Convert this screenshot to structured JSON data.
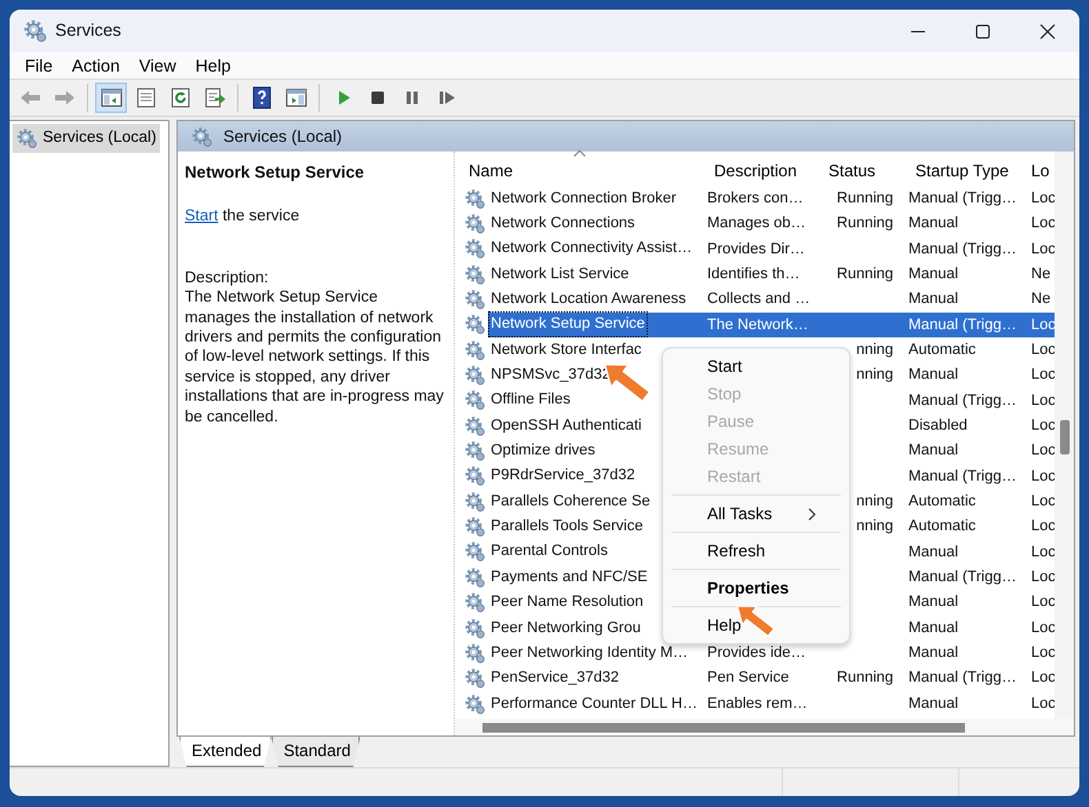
{
  "window": {
    "title": "Services"
  },
  "menu_bar": [
    "File",
    "Action",
    "View",
    "Help"
  ],
  "toolbar": [
    {
      "kind": "back",
      "disabled": true,
      "pressed": false
    },
    {
      "kind": "forward",
      "disabled": true,
      "pressed": false
    },
    {
      "kind": "separator"
    },
    {
      "kind": "console-tree",
      "disabled": false,
      "pressed": true
    },
    {
      "kind": "properties",
      "disabled": false,
      "pressed": false
    },
    {
      "kind": "refresh",
      "disabled": false,
      "pressed": false
    },
    {
      "kind": "export",
      "disabled": false,
      "pressed": false
    },
    {
      "kind": "separator"
    },
    {
      "kind": "help",
      "disabled": false,
      "pressed": false
    },
    {
      "kind": "show-pane",
      "disabled": false,
      "pressed": false
    },
    {
      "kind": "separator"
    },
    {
      "kind": "start",
      "disabled": false,
      "pressed": false
    },
    {
      "kind": "stop",
      "disabled": false,
      "pressed": false
    },
    {
      "kind": "pause",
      "disabled": false,
      "pressed": false
    },
    {
      "kind": "resume",
      "disabled": false,
      "pressed": false
    }
  ],
  "tree": {
    "items": [
      {
        "label": "Services (Local)",
        "selected": true
      }
    ]
  },
  "pane_header": "Services (Local)",
  "details": {
    "title": "Network Setup Service",
    "action_link": "Start",
    "action_text": "the service",
    "description_label": "Description:",
    "description": "The Network Setup Service manages the installation of network drivers and permits the configuration of low-level network settings.  If this service is stopped, any driver installations that are in-progress may be cancelled."
  },
  "table": {
    "columns": [
      {
        "label": "Name",
        "sorted": true
      },
      {
        "label": "Description",
        "sorted": false
      },
      {
        "label": "Status",
        "sorted": false
      },
      {
        "label": "Startup Type",
        "sorted": false
      },
      {
        "label": "Lo",
        "sorted": false
      }
    ],
    "rows": [
      {
        "name": "Network Connection Broker",
        "description": "Brokers con…",
        "status": "Running",
        "startup_type": "Manual (Trigg…",
        "log_on_as": "Loc",
        "selected": false
      },
      {
        "name": "Network Connections",
        "description": "Manages ob…",
        "status": "Running",
        "startup_type": "Manual",
        "log_on_as": "Loc",
        "selected": false
      },
      {
        "name": "Network Connectivity Assist…",
        "description": "Provides Dir…",
        "startup_type": "Manual (Trigg…",
        "log_on_as": "Loc",
        "selected": false
      },
      {
        "name": "Network List Service",
        "description": "Identifies th…",
        "status": "Running",
        "startup_type": "Manual",
        "log_on_as": "Ne",
        "selected": false
      },
      {
        "name": "Network Location Awareness",
        "description": "Collects and …",
        "startup_type": "Manual",
        "log_on_as": "Ne",
        "selected": false
      },
      {
        "name": "Network Setup Service",
        "description": "The Network…",
        "startup_type": "Manual (Trigg…",
        "log_on_as": "Loc",
        "selected": true
      },
      {
        "name": "Network Store Interfac",
        "status": "nning",
        "startup_type": "Automatic",
        "log_on_as": "Loc",
        "selected": false
      },
      {
        "name": "NPSMSvc_37d32",
        "status": "nning",
        "startup_type": "Manual",
        "log_on_as": "Loc",
        "selected": false
      },
      {
        "name": "Offline Files",
        "startup_type": "Manual (Trigg…",
        "log_on_as": "Loc",
        "selected": false
      },
      {
        "name": "OpenSSH Authenticati",
        "startup_type": "Disabled",
        "log_on_as": "Loc",
        "selected": false
      },
      {
        "name": "Optimize drives",
        "startup_type": "Manual",
        "log_on_as": "Loc",
        "selected": false
      },
      {
        "name": "P9RdrService_37d32",
        "startup_type": "Manual (Trigg…",
        "log_on_as": "Loc",
        "selected": false
      },
      {
        "name": "Parallels Coherence Se",
        "status": "nning",
        "startup_type": "Automatic",
        "log_on_as": "Loc",
        "selected": false
      },
      {
        "name": "Parallels Tools Service",
        "status": "nning",
        "startup_type": "Automatic",
        "log_on_as": "Loc",
        "selected": false
      },
      {
        "name": "Parental Controls",
        "startup_type": "Manual",
        "log_on_as": "Loc",
        "selected": false
      },
      {
        "name": "Payments and NFC/SE",
        "startup_type": "Manual (Trigg…",
        "log_on_as": "Loc",
        "selected": false
      },
      {
        "name": "Peer Name Resolution",
        "startup_type": "Manual",
        "log_on_as": "Loc",
        "selected": false
      },
      {
        "name": "Peer Networking Grou",
        "startup_type": "Manual",
        "log_on_as": "Loc",
        "selected": false
      },
      {
        "name": "Peer Networking Identity M…",
        "description": "Provides ide…",
        "startup_type": "Manual",
        "log_on_as": "Loc",
        "selected": false
      },
      {
        "name": "PenService_37d32",
        "description": "Pen Service",
        "status": "Running",
        "startup_type": "Manual (Trigg…",
        "log_on_as": "Loc",
        "selected": false
      },
      {
        "name": "Performance Counter DLL H…",
        "description": "Enables rem…",
        "startup_type": "Manual",
        "log_on_as": "Loc",
        "selected": false
      }
    ]
  },
  "context_menu": {
    "items": [
      {
        "kind": "item",
        "label": "Start",
        "disabled": false,
        "bold": false,
        "submenu": false
      },
      {
        "kind": "item",
        "label": "Stop",
        "disabled": true,
        "bold": false,
        "submenu": false
      },
      {
        "kind": "item",
        "label": "Pause",
        "disabled": true,
        "bold": false,
        "submenu": false
      },
      {
        "kind": "item",
        "label": "Resume",
        "disabled": true,
        "bold": false,
        "submenu": false
      },
      {
        "kind": "item",
        "label": "Restart",
        "disabled": true,
        "bold": false,
        "submenu": false
      },
      {
        "kind": "separator"
      },
      {
        "kind": "item",
        "label": "All Tasks",
        "disabled": false,
        "bold": false,
        "submenu": true
      },
      {
        "kind": "separator"
      },
      {
        "kind": "item",
        "label": "Refresh",
        "disabled": false,
        "bold": false,
        "submenu": false
      },
      {
        "kind": "separator"
      },
      {
        "kind": "item",
        "label": "Properties",
        "disabled": false,
        "bold": true,
        "submenu": false
      },
      {
        "kind": "separator"
      },
      {
        "kind": "item",
        "label": "Help",
        "disabled": false,
        "bold": false,
        "submenu": false
      }
    ]
  },
  "view_tabs": [
    {
      "label": "Extended",
      "selected": true
    },
    {
      "label": "Standard",
      "selected": false
    }
  ]
}
